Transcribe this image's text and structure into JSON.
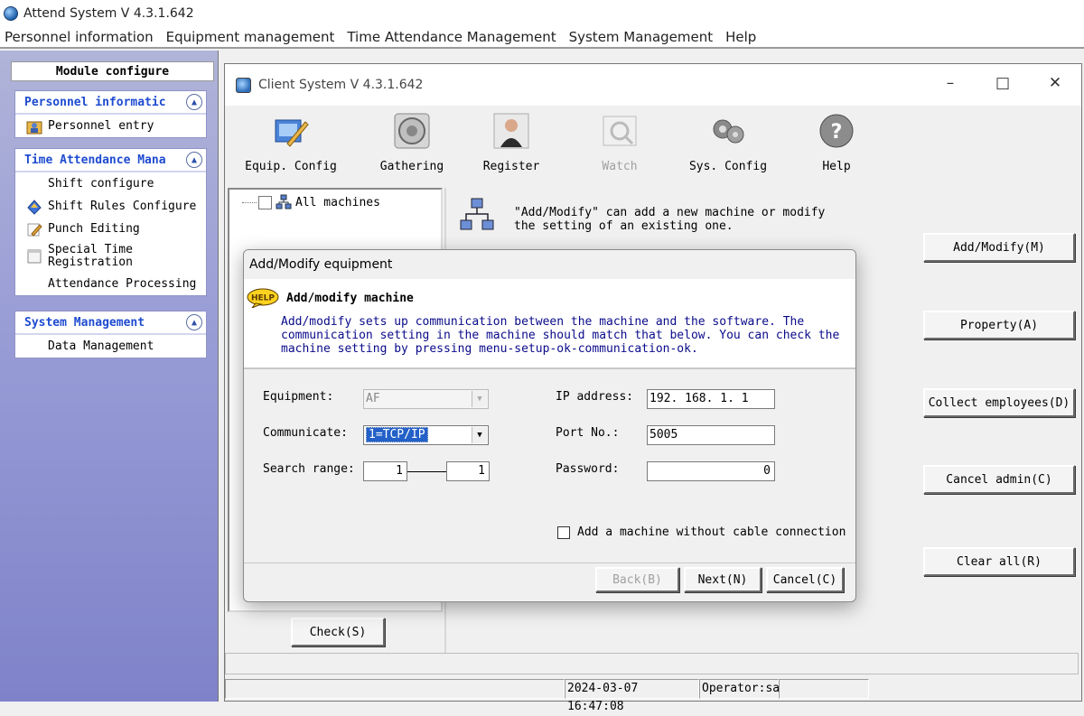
{
  "app": {
    "title": "Attend System V 4.3.1.642"
  },
  "menu": [
    "Personnel information",
    "Equipment management",
    "Time Attendance Management",
    "System Management",
    "Help"
  ],
  "left_panel": {
    "header": "Module configure",
    "groups": [
      {
        "title": "Personnel informatic",
        "items": [
          "Personnel entry"
        ]
      },
      {
        "title": "Time Attendance Mana",
        "items": [
          "Shift configure",
          "Shift Rules Configure",
          "Punch Editing",
          "Special Time Registration",
          "Attendance Processing"
        ]
      },
      {
        "title": "System Management",
        "items": [
          "Data Management"
        ]
      }
    ]
  },
  "client": {
    "title": "Client System V 4.3.1.642",
    "toolbar": [
      "Equip. Config",
      "Gathering",
      "Register",
      "Watch",
      "Sys. Config",
      "Help"
    ],
    "tree_root": "All machines",
    "info_text": "\"Add/Modify\" can add a new machine or modify the setting of an existing one.",
    "buttons": {
      "add_modify": "Add/Modify(M)",
      "property": "Property(A)",
      "collect": "Collect employees(D)",
      "cancel_admin": "Cancel admin(C)",
      "clear_all": "Clear all(R)",
      "check": "Check(S)"
    },
    "status": {
      "datetime": "2024-03-07 16:47:08",
      "operator": "Operator:sa"
    }
  },
  "dialog": {
    "title": "Add/Modify equipment",
    "help_badge": "HELP",
    "head_title": "Add/modify machine",
    "head_desc": "Add/modify sets up communication between the machine and the software. The communication setting in the machine should match that below. You can check the machine setting by pressing menu-setup-ok-communication-ok.",
    "equipment_label": "Equipment:",
    "equipment_value": "AF",
    "communicate_label": "Communicate:",
    "communicate_value": "1=TCP/IP",
    "search_label": "Search range:",
    "search_from": "1",
    "search_to": "1",
    "ip_label": "IP address:",
    "ip_value": "192. 168. 1. 1",
    "port_label": "Port No.:",
    "port_value": "5005",
    "password_label": "Password:",
    "password_value": "0",
    "no_cable_label": "Add a machine without cable connection",
    "back": "Back(B)",
    "next": "Next(N)",
    "cancel": "Cancel(C)"
  }
}
